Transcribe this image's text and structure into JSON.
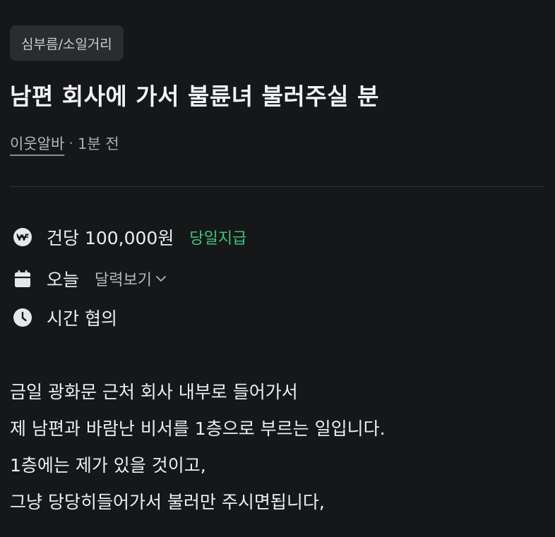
{
  "category": "심부름/소일거리",
  "post": {
    "title": "남편 회사에 가서 불륜녀 불러주실 분",
    "author": "이웃알바",
    "separator": "·",
    "time_ago": "1분 전"
  },
  "info": {
    "pay_text": "건당 100,000원",
    "pay_badge": "당일지급",
    "date_text": "오늘",
    "calendar_toggle": "달력보기",
    "time_text": "시간 협의"
  },
  "description": [
    "금일 광화문 근처 회사 내부로 들어가서",
    "제 남편과 바람난 비서를 1층으로 부르는 일입니다.",
    "1층에는 제가 있을 것이고,",
    "그냥 당당히들어가서 불러만 주시면됩니다,"
  ],
  "icons": {
    "pay": "won-coin-icon",
    "date": "calendar-icon",
    "time": "clock-icon",
    "toggle": "chevron-down-icon"
  },
  "colors": {
    "background": "#161719",
    "text": "#eceef1",
    "accent_green": "#3ec47c",
    "muted": "#a9acb1"
  }
}
